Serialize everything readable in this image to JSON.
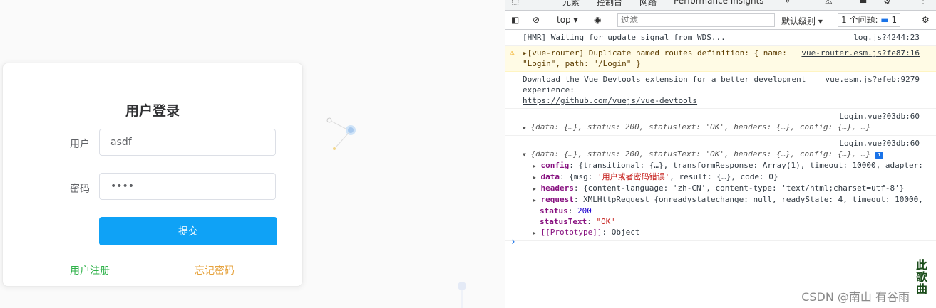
{
  "login": {
    "title": "用户登录",
    "user_label": "用户",
    "user_value": "asdf",
    "password_label": "密码",
    "password_value": "••••",
    "submit_label": "提交",
    "register_link": "用户注册",
    "forgot_link": "忘记密码"
  },
  "devtools": {
    "tabs": [
      "元素",
      "控制台",
      "网络",
      "Performance insights"
    ],
    "warn_count": "1",
    "issue_badge_count": "1",
    "context": "top",
    "filter_placeholder": "过滤",
    "log_level": "默认级别",
    "issues_label": "1 个问题:",
    "issues_count": "1",
    "messages": [
      {
        "text": "[HMR] Waiting for update signal from WDS...",
        "source": "log.js?4244:23"
      },
      {
        "text": "▸[vue-router] Duplicate named routes definition: { name: \"Login\", path: \"/Login\" }",
        "source": "vue-router.esm.js?fe87:16"
      },
      {
        "text": "Download the Vue Devtools extension for a better development experience:",
        "link": "https://github.com/vuejs/vue-devtools",
        "source": "vue.esm.js?efeb:9279"
      },
      {
        "source": "Login.vue?03db:60",
        "summary": "{data: {…}, status: 200, statusText: 'OK', headers: {…}, config: {…}, …}"
      },
      {
        "source": "Login.vue?03db:60",
        "summary": "{data: {…}, status: 200, statusText: 'OK', headers: {…}, config: {…}, …}"
      }
    ],
    "expanded": {
      "config_key": "config",
      "config_val": "{transitional: {…}, transformResponse: Array(1), timeout: 10000, adapter:",
      "data_key": "data",
      "data_val_pre": "{msg: ",
      "data_msg": "'用户或者密码错误'",
      "data_val_post": ", result: {…}, code: 0}",
      "headers_key": "headers",
      "headers_val": "{content-language: 'zh-CN', content-type: 'text/html;charset=utf-8'}",
      "request_key": "request",
      "request_val": "XMLHttpRequest {onreadystatechange: null, readyState: 4, timeout: 10000,",
      "status_key": "status",
      "status_val": "200",
      "statustext_key": "statusText",
      "statustext_val": "\"OK\"",
      "proto_key": "[[Prototype]]",
      "proto_val": "Object"
    }
  },
  "watermark": "CSDN @南山 有谷雨",
  "seal_text": "此歌曲",
  "colors": {
    "primary": "#0fa2f6",
    "register": "#2fb24a",
    "forgot": "#e6a23c",
    "warn_bg": "#fffbe5"
  }
}
